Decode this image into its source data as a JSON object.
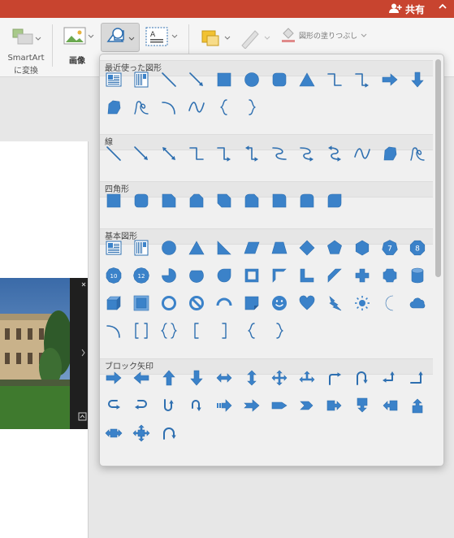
{
  "titlebar": {
    "share_label": "共有",
    "collapse_glyph": "^"
  },
  "ribbon": {
    "smartart_label": "SmartArt",
    "smartart_label2": "に変換",
    "picture_label": "画像",
    "fill_label": "図形の塗りつぶし"
  },
  "colors": {
    "accent": "#c8442f",
    "shape_blue": "#3b82c9",
    "shape_stroke": "#2e6fb0"
  },
  "popup": {
    "sections": [
      {
        "label": "最近使った図形",
        "icons": [
          [
            "text-box-icon",
            "vertical-text-box-icon",
            "line-icon",
            "arrow-line-icon",
            "rectangle-icon",
            "oval-icon",
            "rounded-rect-icon",
            "triangle-icon",
            "elbow-connector-icon",
            "elbow-arrow-connector-icon",
            "right-arrow-icon",
            "down-arrow-icon"
          ],
          [
            "freeform-icon",
            "scribble-icon",
            "arc-icon",
            "curve-icon",
            "left-brace-icon",
            "right-brace-icon"
          ]
        ]
      },
      {
        "label": "線",
        "icons": [
          [
            "line-icon",
            "arrow-line-icon",
            "double-arrow-line-icon",
            "elbow-connector-icon",
            "elbow-arrow-connector-icon",
            "elbow-double-arrow-icon",
            "curved-connector-icon",
            "curved-arrow-connector-icon",
            "curved-double-arrow-icon",
            "curve-icon",
            "freeform-icon",
            "scribble-icon"
          ]
        ]
      },
      {
        "label": "四角形",
        "icons": [
          [
            "rectangle-icon",
            "rounded-rect-icon",
            "snip-single-corner-icon",
            "snip-same-side-icon",
            "snip-diagonal-icon",
            "snip-round-icon",
            "round-single-corner-icon",
            "round-same-side-icon",
            "round-diagonal-icon"
          ]
        ]
      },
      {
        "label": "基本図形",
        "icons": [
          [
            "text-box-icon",
            "vertical-text-box-icon",
            "oval-icon",
            "triangle-icon",
            "right-triangle-icon",
            "parallelogram-icon",
            "trapezoid-icon",
            "diamond-icon",
            "pentagon-icon",
            "hexagon-icon",
            "heptagon-icon",
            "octagon-icon"
          ],
          [
            "decagon-icon",
            "dodecagon-icon",
            "pie-icon",
            "chord-icon",
            "teardrop-icon",
            "frame-icon",
            "half-frame-icon",
            "l-shape-icon",
            "diagonal-stripe-icon",
            "cross-icon",
            "plaque-icon",
            "can-icon"
          ],
          [
            "cube-icon",
            "bevel-icon",
            "donut-icon",
            "no-symbol-icon",
            "block-arc-icon",
            "folded-corner-icon",
            "smiley-icon",
            "heart-icon",
            "lightning-icon",
            "sun-icon",
            "moon-icon",
            "cloud-icon"
          ],
          [
            "arc-icon",
            "double-bracket-icon",
            "double-brace-icon",
            "left-bracket-icon",
            "right-bracket-icon",
            "left-brace-icon",
            "right-brace-icon"
          ]
        ]
      },
      {
        "label": "ブロック矢印",
        "icons": [
          [
            "right-arrow-icon",
            "left-arrow-icon",
            "up-arrow-icon",
            "down-arrow-icon",
            "left-right-arrow-icon",
            "up-down-arrow-icon",
            "quad-arrow-icon",
            "left-right-up-arrow-icon",
            "bent-arrow-icon",
            "u-turn-arrow-icon",
            "left-up-arrow-icon",
            "bent-up-arrow-icon"
          ],
          [
            "curved-right-arrow-icon",
            "curved-left-arrow-icon",
            "curved-up-arrow-icon",
            "curved-down-arrow-icon",
            "striped-right-arrow-icon",
            "notched-right-arrow-icon",
            "pentagon-arrow-icon",
            "chevron-icon",
            "right-arrow-callout-icon",
            "down-arrow-callout-icon",
            "left-arrow-callout-icon",
            "up-arrow-callout-icon"
          ],
          [
            "left-right-arrow-callout-icon",
            "quad-arrow-callout-icon",
            "circular-arrow-icon"
          ]
        ]
      }
    ]
  }
}
